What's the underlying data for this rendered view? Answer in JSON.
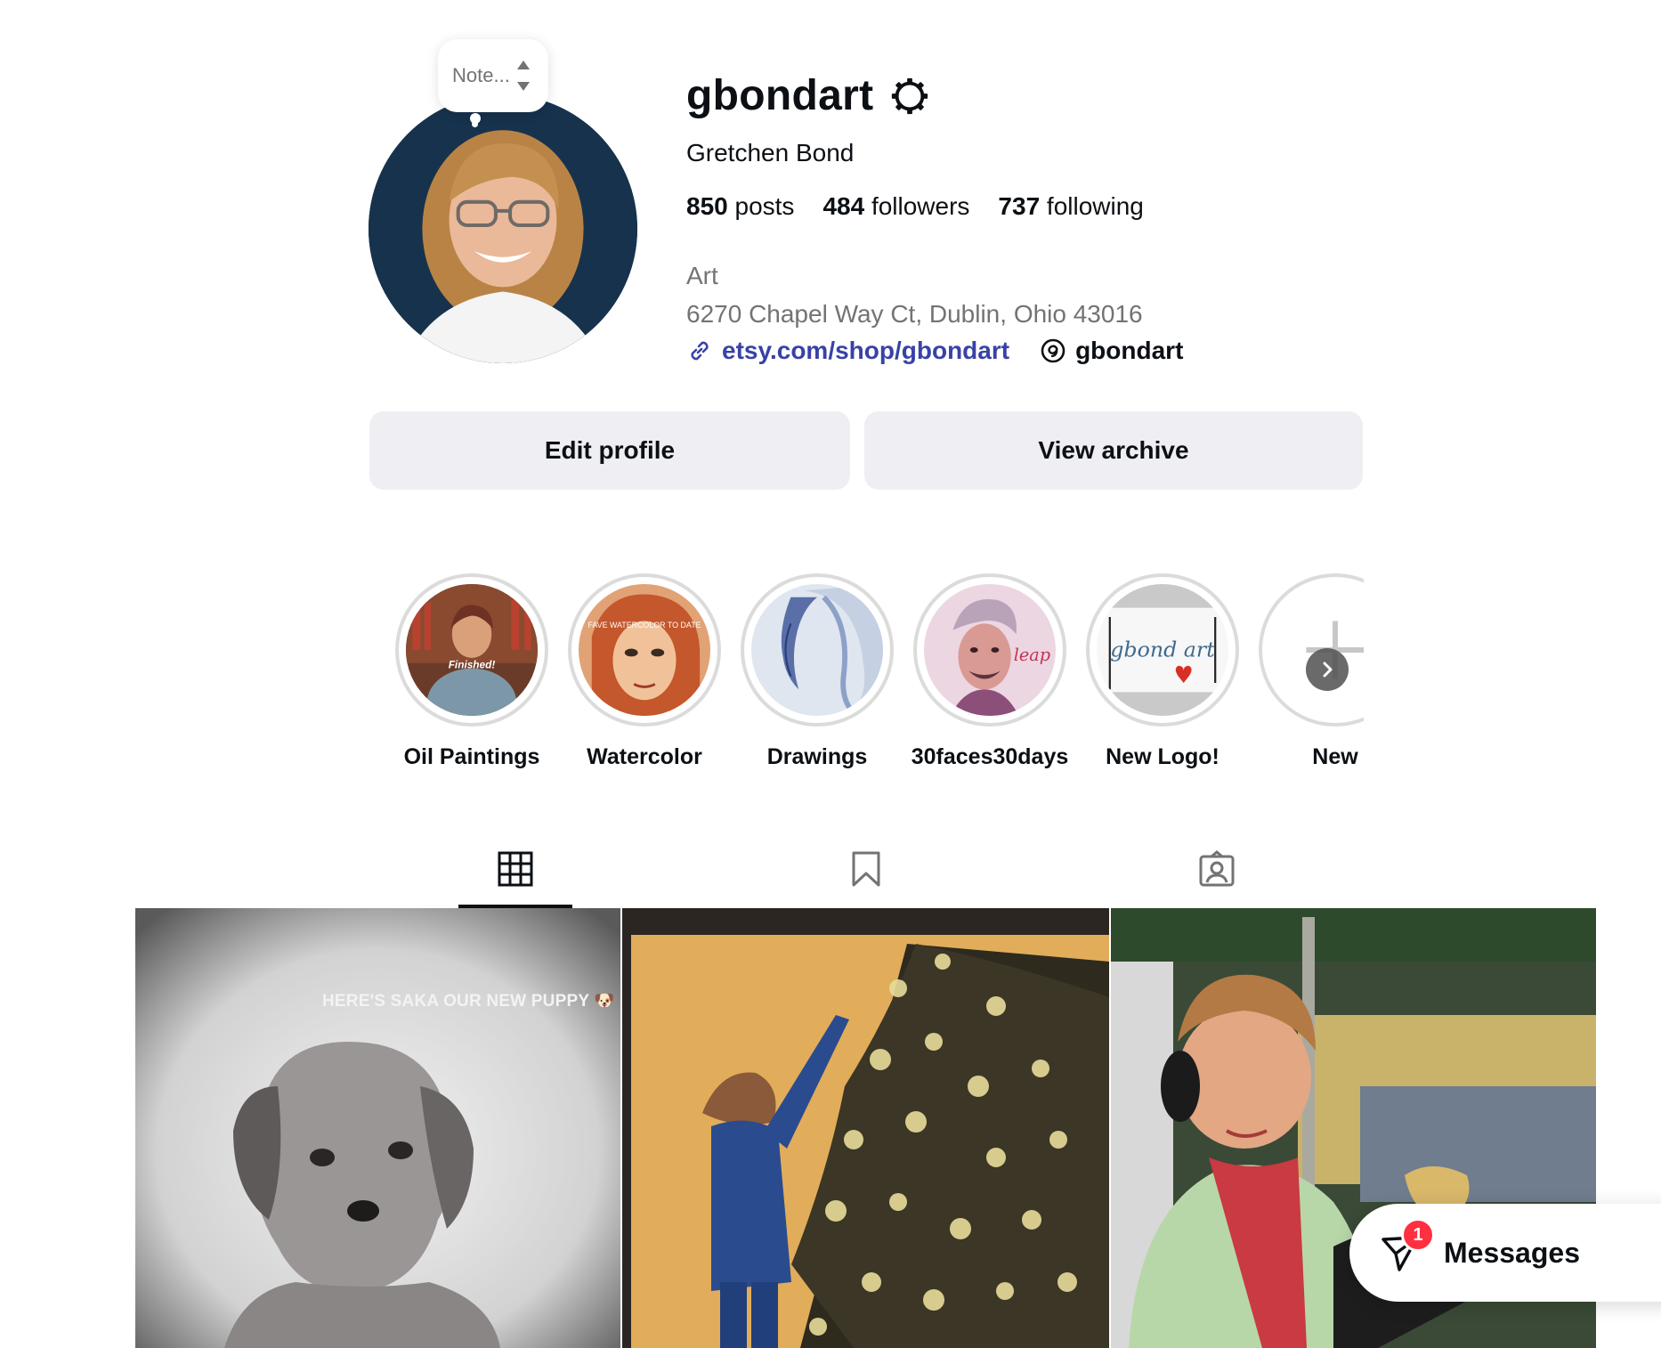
{
  "profile": {
    "username": "gbondart",
    "full_name": "Gretchen Bond",
    "note_placeholder": "Note...",
    "stats": {
      "posts_count": "850",
      "posts_label": "posts",
      "followers_count": "484",
      "followers_label": "followers",
      "following_count": "737",
      "following_label": "following"
    },
    "category": "Art",
    "address": "6270 Chapel Way Ct, Dublin, Ohio 43016",
    "website": "etsy.com/shop/gbondart",
    "threads_handle": "gbondart"
  },
  "actions": {
    "edit_profile": "Edit profile",
    "view_archive": "View archive"
  },
  "highlights": [
    {
      "label": "Oil Paintings",
      "overlay": "Finished!"
    },
    {
      "label": "Watercolor",
      "overlay": "FAVE WATERCOLOR TO DATE"
    },
    {
      "label": "Drawings"
    },
    {
      "label": "30faces30days",
      "overlay": "leap"
    },
    {
      "label": "New Logo!",
      "overlay": "gbond art"
    },
    {
      "label": "New",
      "icon": "plus-icon"
    }
  ],
  "tabs": [
    {
      "name": "posts",
      "icon": "grid-icon",
      "active": true
    },
    {
      "name": "saved",
      "icon": "bookmark-icon",
      "active": false
    },
    {
      "name": "tagged",
      "icon": "tagged-user-icon",
      "active": false
    }
  ],
  "posts": [
    {
      "caption": "HERE'S SAKA OUR NEW PUPPY 🐶",
      "subject": "puppy sketch"
    },
    {
      "subject": "child decorating christmas tree painting"
    },
    {
      "subject": "girl with earmuffs painting"
    }
  ],
  "messages": {
    "label": "Messages",
    "badge": "1"
  },
  "colors": {
    "link": "#3842a6",
    "button_bg": "#efeff3",
    "badge": "#ff3040",
    "secondary_text": "#737373"
  }
}
